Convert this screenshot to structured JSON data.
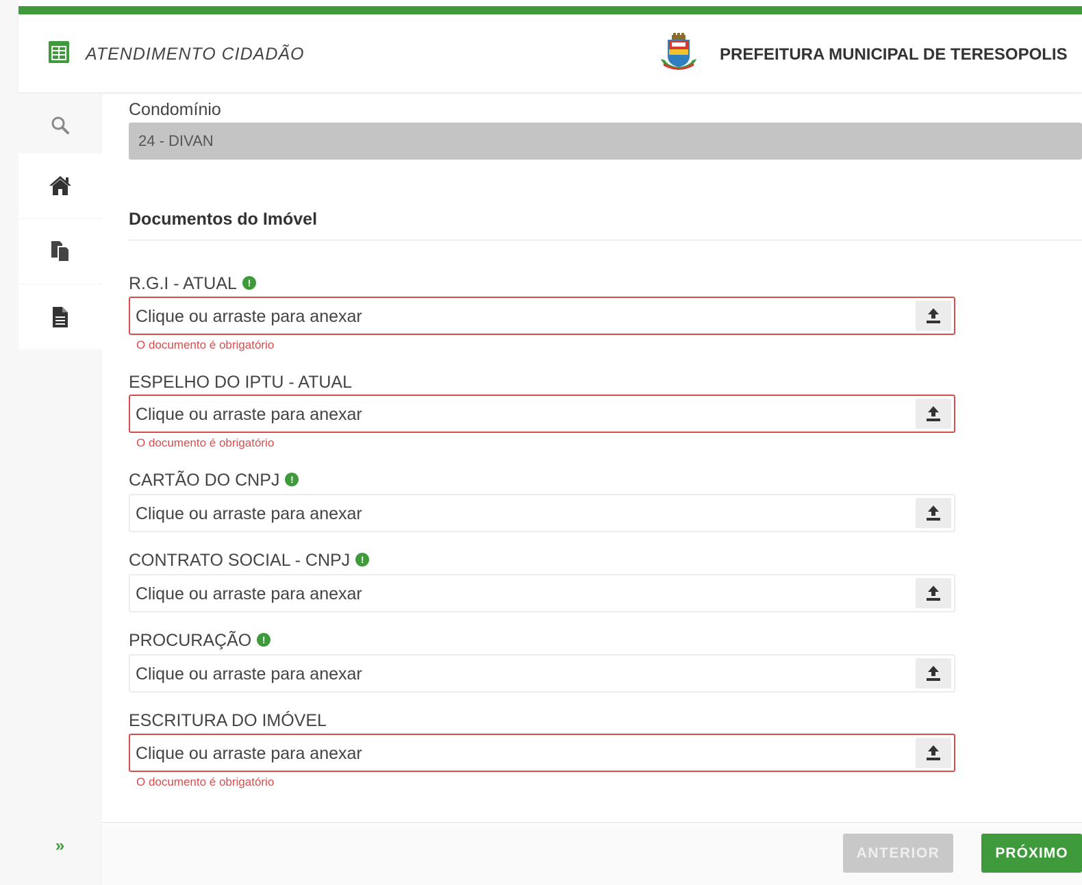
{
  "header": {
    "app_title": "ATENDIMENTO CIDADÃO",
    "app_icon": "table-icon",
    "crest_icon": "city-crest-icon",
    "city_title": "PREFEITURA MUNICIPAL DE TERESOPOLIS"
  },
  "sidebar": {
    "items": [
      {
        "icon": "search-icon"
      },
      {
        "icon": "home-icon"
      },
      {
        "icon": "copy-documents-icon"
      },
      {
        "icon": "file-icon"
      }
    ],
    "expand_label": "»"
  },
  "form": {
    "condo_label": "Condomínio",
    "condo_value": "24 - DIVAN",
    "section_title": "Documentos do Imóvel",
    "upload_placeholder": "Clique ou arraste para anexar",
    "required_message": "O documento é obrigatório",
    "documents": [
      {
        "label": "R.G.I - ATUAL",
        "info": true,
        "error": true
      },
      {
        "label": "ESPELHO DO IPTU - ATUAL",
        "info": false,
        "error": true
      },
      {
        "label": "CARTÃO DO CNPJ",
        "info": true,
        "error": false
      },
      {
        "label": "CONTRATO SOCIAL - CNPJ",
        "info": true,
        "error": false
      },
      {
        "label": "PROCURAÇÃO",
        "info": true,
        "error": false
      },
      {
        "label": "ESCRITURA DO IMÓVEL",
        "info": false,
        "error": true
      }
    ]
  },
  "footer": {
    "prev_label": "ANTERIOR",
    "next_label": "PRÓXIMO"
  },
  "colors": {
    "accent": "#3f9a3c",
    "error": "#d94c4c",
    "disabled": "#c8c8c8"
  }
}
